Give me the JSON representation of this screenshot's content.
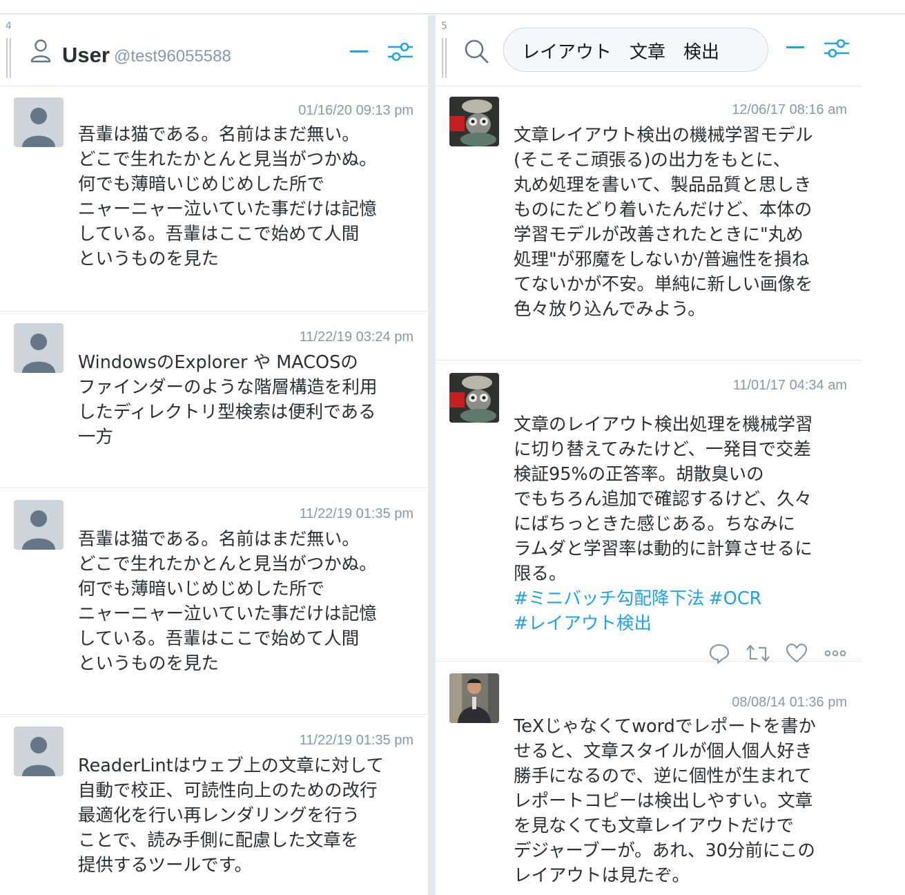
{
  "colors": {
    "accent": "#1da1f2",
    "muted": "#8899a6",
    "divider": "#e1e8ed",
    "text": "#292f33"
  },
  "columns": [
    {
      "number": "4",
      "header": {
        "icon": "user-icon",
        "title": "User",
        "handle": "@test96055588"
      },
      "tweets": [
        {
          "time": "01/16/20 09:13 pm",
          "avatar": "default-avatar",
          "text": "吾輩は猫である。名前はまだ無い。\nどこで生れたかとんと見当がつかぬ。\n何でも薄暗いじめじめした所で\nニャーニャー泣いていた事だけは記憶\nしている。吾輩はここで始めて人間\nというものを見た"
        },
        {
          "time": "11/22/19 03:24 pm",
          "avatar": "default-avatar",
          "text": "WindowsのExplorer や MACOSの\nファインダーのような階層構造を利用\nしたディレクトリ型検索は便利である\n一方"
        },
        {
          "time": "11/22/19 01:35 pm",
          "avatar": "default-avatar",
          "text": "吾輩は猫である。名前はまだ無い。\nどこで生れたかとんと見当がつかぬ。\n何でも薄暗いじめじめした所で\nニャーニャー泣いていた事だけは記憶\nしている。吾輩はここで始めて人間\nというものを見た"
        },
        {
          "time": "11/22/19 01:35 pm",
          "avatar": "default-avatar",
          "text": "ReaderLintはウェブ上の文章に対して\n自動で校正、可読性向上のための改行\n最適化を行い再レンダリングを行う\nことで、読み手側に配慮した文章を\n提供するツールです。"
        }
      ]
    },
    {
      "number": "5",
      "header": {
        "icon": "search-icon",
        "search_value": "レイアウト　文章　検出"
      },
      "tweets": [
        {
          "time": "12/06/17 08:16 am",
          "avatar": "photo-avatar-figurine",
          "text": "文章レイアウト検出の機械学習モデル\n(そこそこ頑張る)の出力をもとに、\n丸め処理を書いて、製品品質と思しき\nものにたどり着いたんだけど、本体の\n学習モデルが改善されたときに\"丸め\n処理\"が邪魔をしないか/普遍性を損ね\nてないかが不安。単純に新しい画像を\n色々放り込んでみよう。"
        },
        {
          "time": "11/01/17 04:34 am",
          "avatar": "photo-avatar-figurine",
          "text": "文章のレイアウト検出処理を機械学習\nに切り替えてみたけど、一発目で交差\n検証95%の正答率。胡散臭いの\nでもちろん追加で確認するけど、久々\nにばちっときた感じある。ちなみに\nラムダと学習率は動的に計算させるに\n限る。",
          "hashtags": [
            "#ミニバッチ勾配降下法",
            "#OCR",
            "#レイアウト検出"
          ],
          "actions": [
            "reply-icon",
            "retweet-icon",
            "like-icon",
            "more-icon"
          ]
        },
        {
          "time": "08/08/14 01:36 pm",
          "avatar": "photo-avatar-person",
          "text": "TeXじゃなくてwordでレポートを書か\nせると、文章スタイルが個人個人好き\n勝手になるので、逆に個性が生まれて\nレポートコピーは検出しやすい。文章\nを見なくても文章レイアウトだけで\nデジャーブーが。あれ、30分前にこの\nレイアウトは見たぞ。"
        }
      ]
    }
  ]
}
